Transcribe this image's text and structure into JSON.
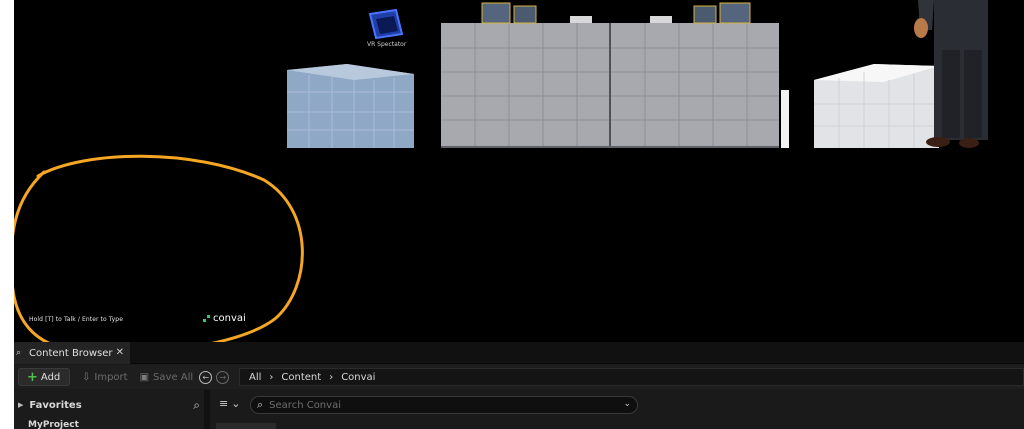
{
  "viewport": {
    "spectator_label": "VR Spectator",
    "hint": "Hold [T] to Talk / Enter to Type",
    "logo_text": "convai"
  },
  "annotation_color": "#f5a623",
  "content_browser": {
    "tab_label": "Content Browser",
    "tab_close": "✕",
    "toolbar": {
      "add_label": "Add",
      "import_label": "Import",
      "save_all_label": "Save All"
    },
    "breadcrumb": [
      "All",
      "Content",
      "Convai"
    ],
    "favorites_label": "Favorites",
    "project_label": "MyProject",
    "search_placeholder": "Search Convai"
  }
}
